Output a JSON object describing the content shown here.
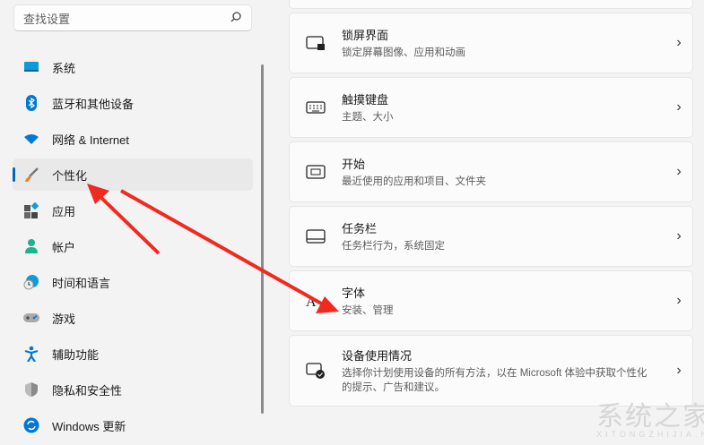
{
  "search": {
    "placeholder": "查找设置"
  },
  "nav": [
    {
      "label": "系统",
      "icon": "monitor-icon",
      "color": "#0f9bd7"
    },
    {
      "label": "蓝牙和其他设备",
      "icon": "bluetooth-icon",
      "color": "#0078d4"
    },
    {
      "label": "网络 & Internet",
      "icon": "wifi-icon",
      "color": "#0078d4"
    },
    {
      "label": "个性化",
      "icon": "brush-icon",
      "color": "#e8822f",
      "active": true
    },
    {
      "label": "应用",
      "icon": "apps-icon",
      "color": "#4a4a4a"
    },
    {
      "label": "帐户",
      "icon": "account-icon",
      "color": "#1db38f"
    },
    {
      "label": "时间和语言",
      "icon": "clock-globe-icon",
      "color": "#0f9bd7"
    },
    {
      "label": "游戏",
      "icon": "gamepad-icon",
      "color": "#8a8a8a"
    },
    {
      "label": "辅助功能",
      "icon": "accessibility-icon",
      "color": "#0078d4"
    },
    {
      "label": "隐私和安全性",
      "icon": "shield-icon",
      "color": "#8a8a8a"
    },
    {
      "label": "Windows 更新",
      "icon": "update-icon",
      "color": "#0078d4"
    }
  ],
  "cards": [
    {
      "title": "锁屏界面",
      "subtitle": "锁定屏幕图像、应用和动画",
      "icon": "lock-screen-icon"
    },
    {
      "title": "触摸键盘",
      "subtitle": "主题、大小",
      "icon": "keyboard-icon"
    },
    {
      "title": "开始",
      "subtitle": "最近使用的应用和项目、文件夹",
      "icon": "start-icon"
    },
    {
      "title": "任务栏",
      "subtitle": "任务栏行为，系统固定",
      "icon": "taskbar-icon"
    },
    {
      "title": "字体",
      "subtitle": "安装、管理",
      "icon": "font-icon"
    },
    {
      "title": "设备使用情况",
      "subtitle": "选择你计划使用设备的所有方法，以在 Microsoft 体验中获取个性化的提示、广告和建议。",
      "icon": "device-usage-icon"
    }
  ],
  "watermark": {
    "text": "系统之家",
    "url_text": "XITONGZHIJIA.NET"
  }
}
